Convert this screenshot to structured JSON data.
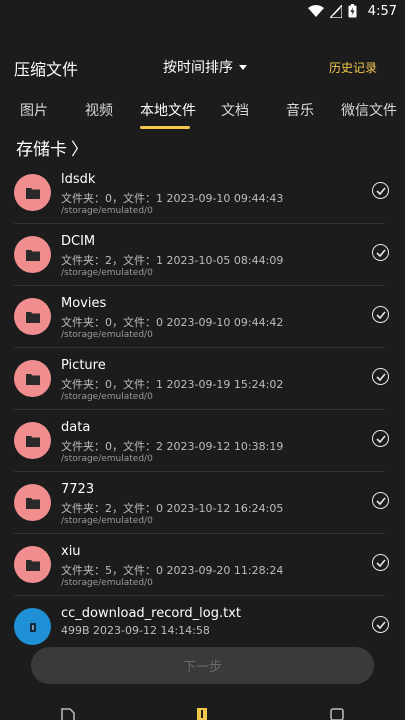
{
  "statusbar": {
    "time": "4:57",
    "icons": [
      "wifi-icon",
      "signal-icon",
      "battery-icon"
    ]
  },
  "header": {
    "title": "压缩文件",
    "sort_label": "按时间排序",
    "history_label": "历史记录"
  },
  "tabs": [
    {
      "label": "图片"
    },
    {
      "label": "视频"
    },
    {
      "label": "本地文件"
    },
    {
      "label": "文档"
    },
    {
      "label": "音乐"
    },
    {
      "label": "微信文件"
    }
  ],
  "active_tab": "本地文件",
  "breadcrumb": {
    "label": "存储卡",
    "chevron": "〉"
  },
  "files": [
    {
      "name": "ldsdk",
      "meta": "文件夹：0，文件：1  2023-09-10 09:44:43",
      "path": "/storage/emulated/0",
      "icon": "folder-icon"
    },
    {
      "name": "DCIM",
      "meta": "文件夹：2，文件：1  2023-10-05 08:44:09",
      "path": "/storage/emulated/0",
      "icon": "folder-icon"
    },
    {
      "name": "Movies",
      "meta": "文件夹：0，文件：0  2023-09-10 09:44:42",
      "path": "/storage/emulated/0",
      "icon": "folder-icon"
    },
    {
      "name": "Picture",
      "meta": "文件夹：0，文件：1  2023-09-19 15:24:02",
      "path": "/storage/emulated/0",
      "icon": "folder-icon"
    },
    {
      "name": "data",
      "meta": "文件夹：0，文件：2  2023-09-12 10:38:19",
      "path": "/storage/emulated/0",
      "icon": "folder-icon"
    },
    {
      "name": "7723",
      "meta": "文件夹：2，文件：0  2023-10-12 16:24:05",
      "path": "/storage/emulated/0",
      "icon": "folder-icon"
    },
    {
      "name": "xiu",
      "meta": "文件夹：5，文件：0  2023-09-20 11:28:24",
      "path": "/storage/emulated/0",
      "icon": "folder-icon"
    },
    {
      "name": "cc_download_record_log.txt",
      "meta": "499B   2023-09-12 14:14:58",
      "path": "",
      "icon": "document-icon"
    }
  ],
  "next_button": {
    "label": "下一步"
  },
  "colors": {
    "background": "#1c1c1c",
    "accent": "#f2c84b",
    "folder": "#f08d8f",
    "document": "#1f8fd6"
  }
}
